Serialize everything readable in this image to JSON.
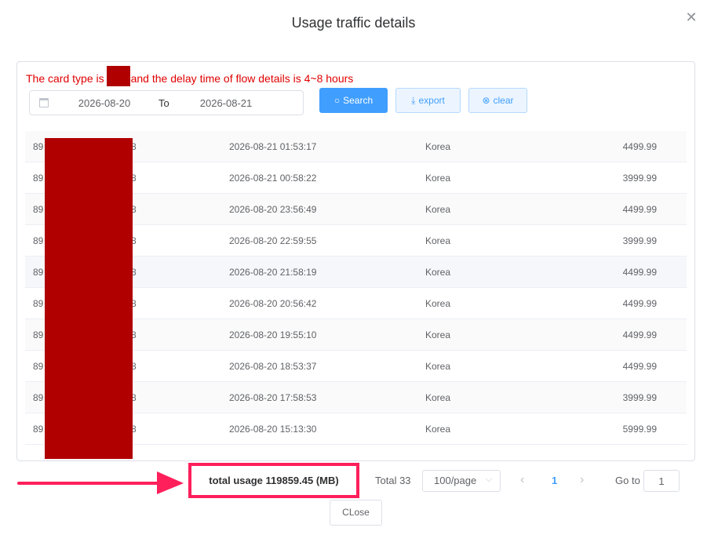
{
  "dialog": {
    "title": "Usage traffic details",
    "close_icon": "close-icon"
  },
  "notice": {
    "prefix": "The card type is",
    "suffix": "and the delay time of flow details is 4~8 hours",
    "color": "#e00000"
  },
  "filter": {
    "start_date": "2026-08-20",
    "separator": "To",
    "end_date": "2026-08-21",
    "search_label": "Search",
    "export_label": "export",
    "clear_label": "clear"
  },
  "table": {
    "rows": [
      {
        "id_prefix": "89",
        "id_suffix": "8",
        "time": "2026-08-21 01:53:17",
        "region": "Korea",
        "usage": "4499.99"
      },
      {
        "id_prefix": "89",
        "id_suffix": "8",
        "time": "2026-08-21 00:58:22",
        "region": "Korea",
        "usage": "3999.99"
      },
      {
        "id_prefix": "89",
        "id_suffix": "8",
        "time": "2026-08-20 23:56:49",
        "region": "Korea",
        "usage": "4499.99"
      },
      {
        "id_prefix": "89",
        "id_suffix": "8",
        "time": "2026-08-20 22:59:55",
        "region": "Korea",
        "usage": "3999.99"
      },
      {
        "id_prefix": "89",
        "id_suffix": "8",
        "time": "2026-08-20 21:58:19",
        "region": "Korea",
        "usage": "4499.99"
      },
      {
        "id_prefix": "89",
        "id_suffix": "8",
        "time": "2026-08-20 20:56:42",
        "region": "Korea",
        "usage": "4499.99"
      },
      {
        "id_prefix": "89",
        "id_suffix": "8",
        "time": "2026-08-20 19:55:10",
        "region": "Korea",
        "usage": "4499.99"
      },
      {
        "id_prefix": "89",
        "id_suffix": "8",
        "time": "2026-08-20 18:53:37",
        "region": "Korea",
        "usage": "4499.99"
      },
      {
        "id_prefix": "89",
        "id_suffix": "8",
        "time": "2026-08-20 17:58:53",
        "region": "Korea",
        "usage": "3999.99"
      },
      {
        "id_prefix": "89",
        "id_suffix": "8",
        "time": "2026-08-20 15:13:30",
        "region": "Korea",
        "usage": "5999.99"
      }
    ]
  },
  "footer": {
    "total_usage": "total usage 119859.45 (MB)",
    "total_count": "Total 33",
    "page_size": "100/page",
    "current_page": "1",
    "goto_label": "Go to",
    "goto_value": "1",
    "close_label": "CLose",
    "highlight_color": "#ff1f5b"
  },
  "colors": {
    "primary": "#409eff",
    "redaction": "#b00000"
  }
}
